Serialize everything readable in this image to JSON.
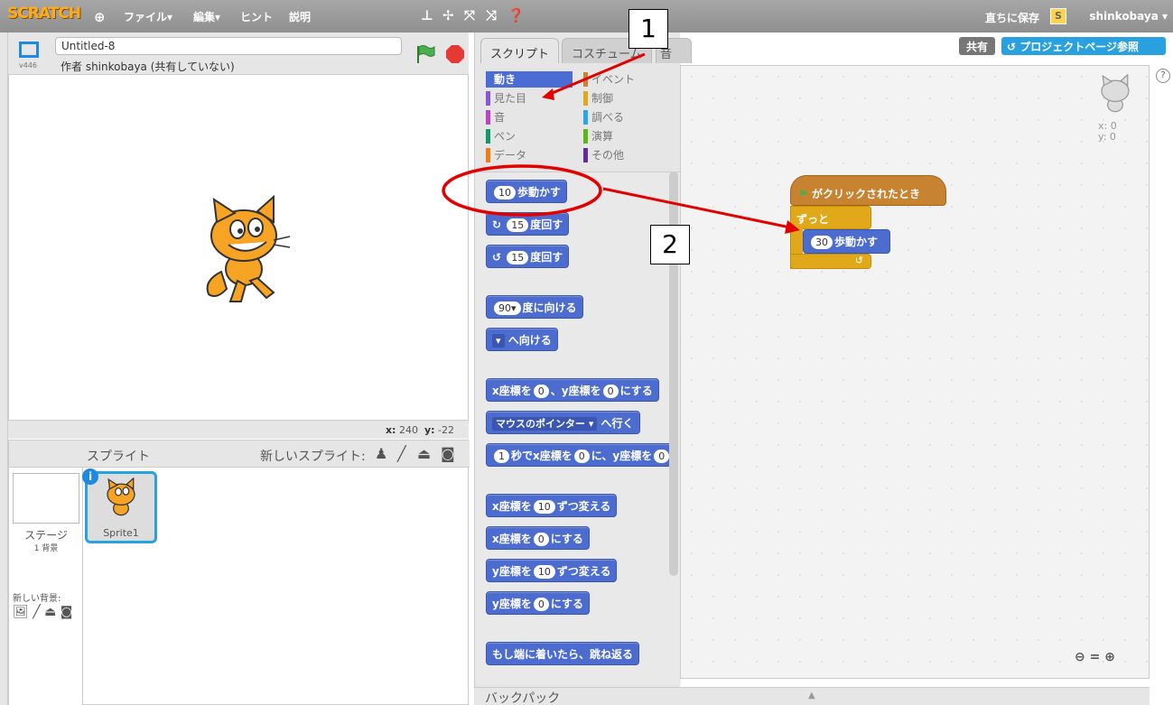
{
  "menubar": {
    "logo": "SCRATCH",
    "menus": [
      "ファイル▾",
      "編集▾",
      "ヒント",
      "説明"
    ],
    "save_now": "直ちに保存",
    "avatar_letter": "S",
    "username": "shinkobaya ▾"
  },
  "stage": {
    "version": "v446",
    "project_title": "Untitled-8",
    "author": "作者 shinkobaya (共有していない)",
    "coords_x_label": "x:",
    "coords_x": "240",
    "coords_y_label": "y:",
    "coords_y": "-22"
  },
  "sprites": {
    "header": "スプライト",
    "new_sprite": "新しいスプライト:",
    "stage_label": "ステージ",
    "stage_backdrops": "1 背景",
    "new_backdrop": "新しい背景:",
    "sprite1_name": "Sprite1"
  },
  "tabs": {
    "scripts": "スクリプト",
    "costumes": "コスチューム",
    "sounds": "音"
  },
  "categories": [
    {
      "label": "動き",
      "color": "#4a6cd4",
      "selected": true
    },
    {
      "label": "イベント",
      "color": "#c88330",
      "selected": false
    },
    {
      "label": "見た目",
      "color": "#8a55d7",
      "selected": false
    },
    {
      "label": "制御",
      "color": "#e1a91a",
      "selected": false
    },
    {
      "label": "音",
      "color": "#bb42c3",
      "selected": false
    },
    {
      "label": "調べる",
      "color": "#2ca5e2",
      "selected": false
    },
    {
      "label": "ペン",
      "color": "#0e9a6c",
      "selected": false
    },
    {
      "label": "演算",
      "color": "#5cb712",
      "selected": false
    },
    {
      "label": "データ",
      "color": "#ee7d16",
      "selected": false
    },
    {
      "label": "その他",
      "color": "#632d99",
      "selected": false
    }
  ],
  "blocks": {
    "move_num": "10",
    "move_label": "歩動かす",
    "turn_r_num": "15",
    "turn_r_label": "度回す",
    "turn_l_num": "15",
    "turn_l_label": "度回す",
    "point_dir_num": "90▾",
    "point_dir_label": "度に向ける",
    "point_towards_label": "へ向ける",
    "goto_xy_a": "x座標を",
    "goto_xy_x": "0",
    "goto_xy_b": "、y座標を",
    "goto_xy_y": "0",
    "goto_xy_c": "にする",
    "goto_mouse_drop": "マウスのポインター ▾",
    "goto_mouse_label": "へ行く",
    "glide_secs": "1",
    "glide_a": "秒でx座標を",
    "glide_x": "0",
    "glide_b": "に、y座標を",
    "glide_y": "0",
    "change_x_a": "x座標を",
    "change_x_num": "10",
    "change_x_b": "ずつ変える",
    "set_x_a": "x座標を",
    "set_x_num": "0",
    "set_x_b": "にする",
    "change_y_a": "y座標を",
    "change_y_num": "10",
    "change_y_b": "ずつ変える",
    "set_y_a": "y座標を",
    "set_y_num": "0",
    "set_y_b": "にする",
    "bounce": "もし端に着いたら、跳ね返る"
  },
  "backpack": "バックパック",
  "script_area": {
    "share": "共有",
    "project_page": "プロジェクトページ参照",
    "sprite_x": "x: 0",
    "sprite_y": "y: 0",
    "hat_label": "がクリックされたとき",
    "forever_label": "ずっと",
    "inner_move_num": "30",
    "inner_move_label": "歩動かす",
    "help": "?"
  },
  "annotations": {
    "one": "1",
    "two": "2"
  }
}
